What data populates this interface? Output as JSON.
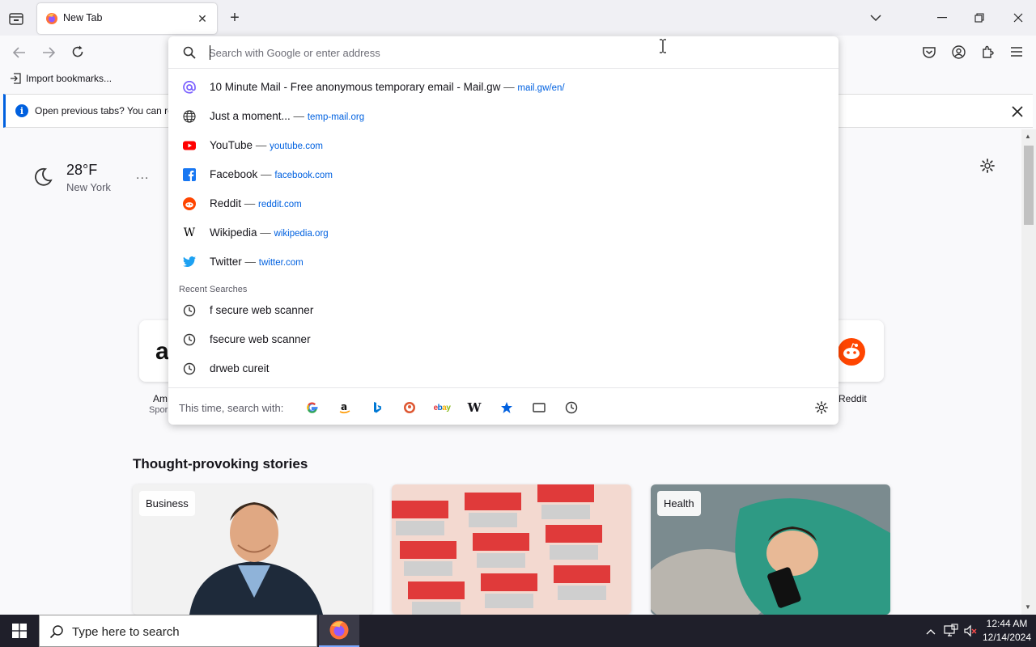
{
  "browser": {
    "tab_title": "New Tab",
    "bookmark_import": "Import bookmarks...",
    "notification_text": "Open previous tabs? You can res"
  },
  "url_dropdown": {
    "placeholder": "Search with Google or enter address",
    "suggestions": [
      {
        "title": "10 Minute Mail - Free anonymous temporary email - Mail.gw",
        "url": "mail.gw/en/",
        "icon": "at-sign-icon",
        "color": "#7b61ff"
      },
      {
        "title": "Just a moment...",
        "url": "temp-mail.org",
        "icon": "globe-icon",
        "color": "#333333"
      },
      {
        "title": "YouTube",
        "url": "youtube.com",
        "icon": "youtube-icon",
        "color": "#ff0000"
      },
      {
        "title": "Facebook",
        "url": "facebook.com",
        "icon": "facebook-icon",
        "color": "#1877f2"
      },
      {
        "title": "Reddit",
        "url": "reddit.com",
        "icon": "reddit-icon",
        "color": "#ff4500"
      },
      {
        "title": "Wikipedia",
        "url": "wikipedia.org",
        "icon": "wikipedia-icon",
        "color": "#000000"
      },
      {
        "title": "Twitter",
        "url": "twitter.com",
        "icon": "twitter-icon",
        "color": "#1da1f2"
      }
    ],
    "separator": "—",
    "recent_label": "Recent Searches",
    "recent": [
      "f secure web scanner",
      "fsecure web scanner",
      "drweb cureit"
    ],
    "footer_text": "This time, search with:",
    "engines": [
      "google-icon",
      "amazon-icon",
      "bing-icon",
      "duckduckgo-icon",
      "ebay-icon",
      "wikipedia-icon",
      "bookmarks-icon",
      "tabs-icon",
      "history-icon"
    ]
  },
  "newtab": {
    "weather_temp": "28°F",
    "weather_city": "New York",
    "weather_more": "...",
    "tile_left_label1": "Am",
    "tile_left_label2": "Spor",
    "tile_right_label": "Reddit",
    "stories_heading": "Thought-provoking stories",
    "cards": [
      {
        "badge": "Business"
      },
      {
        "badge": ""
      },
      {
        "badge": "Health"
      }
    ]
  },
  "taskbar": {
    "search_placeholder": "Type here to search",
    "time": "12:44 AM",
    "date": "12/14/2024"
  },
  "colors": {
    "accent": "#0060df",
    "link": "#0061e0"
  }
}
